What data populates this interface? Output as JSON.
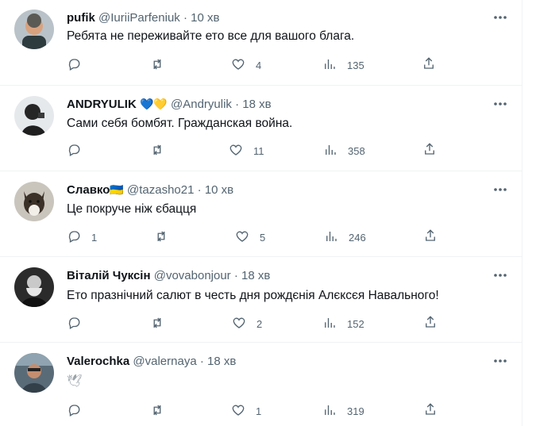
{
  "tweets": [
    {
      "name": "pufik",
      "badge": "",
      "handle": "@IuriiParfeniuk",
      "separator": "·",
      "time": "10 хв",
      "text": "Ребята не переживайте ето все для вашого блага.",
      "replies": "",
      "retweets": "",
      "likes": "4",
      "views": "135"
    },
    {
      "name": "ANDRYULIK",
      "badge": "💙💛",
      "handle": "@Andryulik",
      "separator": "·",
      "time": "18 хв",
      "text": "Сами себя бомбят. Гражданская война.",
      "replies": "",
      "retweets": "",
      "likes": "11",
      "views": "358"
    },
    {
      "name": "Славко",
      "badge": "🇺🇦",
      "handle": "@tazasho21",
      "separator": "·",
      "time": "10 хв",
      "text": "Це покруче ніж єбацця",
      "replies": "1",
      "retweets": "",
      "likes": "5",
      "views": "246"
    },
    {
      "name": "Віталій Чуксін",
      "badge": "",
      "handle": "@vovabonjour",
      "separator": "·",
      "time": "18 хв",
      "text": "Ето празнічний салют в честь дня рождєнія Алєксєя Навального!",
      "replies": "",
      "retweets": "",
      "likes": "2",
      "views": "152"
    },
    {
      "name": "Valerochka",
      "badge": "",
      "handle": "@valernaya",
      "separator": "·",
      "time": "18 хв",
      "text": "🕊",
      "replies": "",
      "retweets": "",
      "likes": "1",
      "views": "319"
    }
  ],
  "icons": {
    "more": "more-icon",
    "reply": "reply-icon",
    "retweet": "retweet-icon",
    "like": "heart-icon",
    "views": "views-icon",
    "share": "share-icon"
  },
  "colors": {
    "text_primary": "#0f1419",
    "text_secondary": "#536471",
    "divider": "#eff3f4"
  }
}
